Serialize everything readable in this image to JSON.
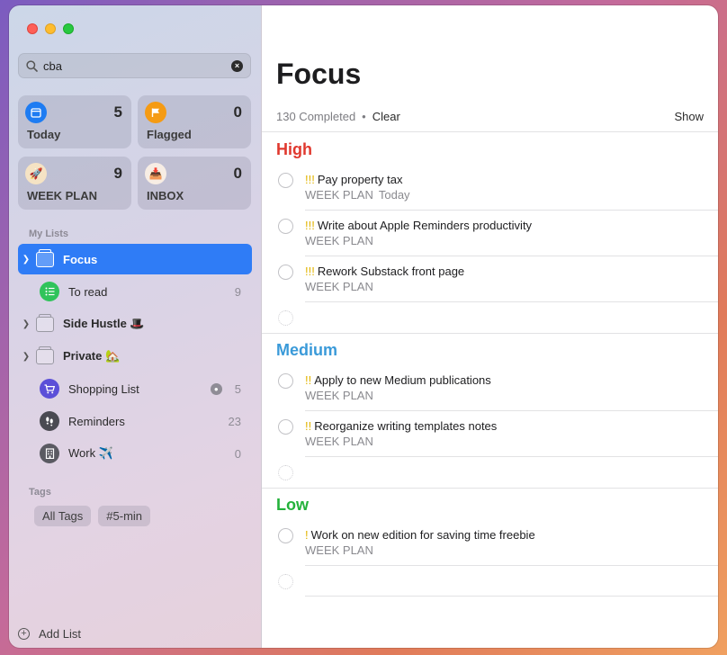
{
  "search": {
    "value": "cba"
  },
  "smart_lists": [
    {
      "label": "Today",
      "count": "5",
      "color": "#1e7cf2",
      "icon": "calendar-icon"
    },
    {
      "label": "Flagged",
      "count": "0",
      "color": "#f59b14",
      "icon": "flag-icon"
    },
    {
      "label": "WEEK PLAN",
      "count": "9",
      "color": "#f5e3c4",
      "icon": "rocket-icon"
    },
    {
      "label": "INBOX",
      "count": "0",
      "color": "#f7ede4",
      "icon": "inbox-icon"
    }
  ],
  "sidebar": {
    "my_lists_label": "My Lists",
    "tags_label": "Tags",
    "lists": [
      {
        "name": "Focus",
        "count": ""
      },
      {
        "name": "To read",
        "count": "9"
      },
      {
        "name": "Side Hustle 🎩",
        "count": ""
      },
      {
        "name": "Private 🏡",
        "count": ""
      },
      {
        "name": "Shopping List",
        "count": "5"
      },
      {
        "name": "Reminders",
        "count": "23"
      },
      {
        "name": "Work ✈️",
        "count": "0"
      }
    ],
    "tags": [
      "All Tags",
      "#5-min"
    ],
    "add_list": "Add List"
  },
  "main": {
    "title": "Focus",
    "completed": "130 Completed",
    "dot": "•",
    "clear": "Clear",
    "show": "Show",
    "groups": [
      {
        "title": "High",
        "color": "#e0382e",
        "tasks": [
          {
            "prio": "!!!",
            "title": "Pay property tax",
            "list": "WEEK PLAN",
            "date": "Today"
          },
          {
            "prio": "!!!",
            "title": "Write about Apple Reminders productivity",
            "list": "WEEK PLAN",
            "date": ""
          },
          {
            "prio": "!!!",
            "title": "Rework Substack front page",
            "list": "WEEK PLAN",
            "date": ""
          }
        ]
      },
      {
        "title": "Medium",
        "color": "#3a9ad9",
        "tasks": [
          {
            "prio": "!!",
            "title": "Apply to new Medium publications",
            "list": "WEEK PLAN",
            "date": ""
          },
          {
            "prio": "!!",
            "title": "Reorganize writing templates notes",
            "list": "WEEK PLAN",
            "date": ""
          }
        ]
      },
      {
        "title": "Low",
        "color": "#24b23b",
        "tasks": [
          {
            "prio": "!",
            "title": "Work on new edition for saving time freebie",
            "list": "WEEK PLAN",
            "date": ""
          }
        ]
      }
    ]
  }
}
